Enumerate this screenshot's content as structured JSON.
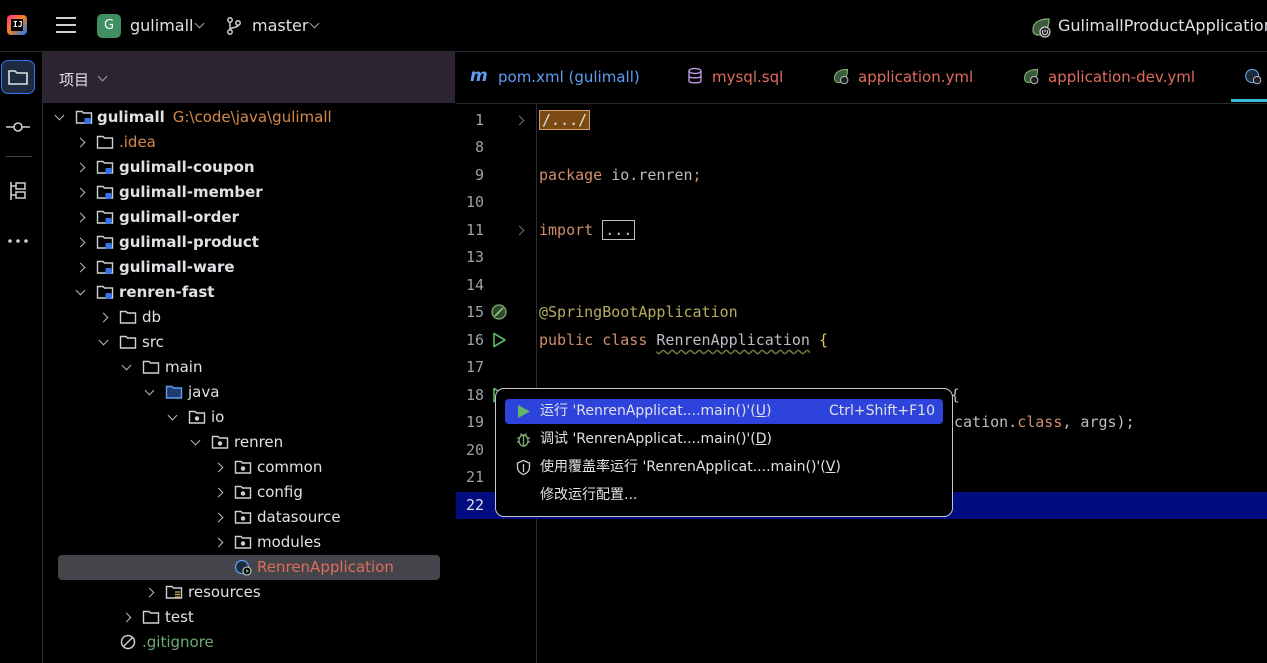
{
  "topbar": {
    "project_badge": "G",
    "project_name": "gulimall",
    "branch": "master",
    "run_config": "GulimallProductApplication"
  },
  "project_panel": {
    "title": "项目",
    "root_label": "gulimall",
    "root_path": "G:\\code\\java\\gulimall",
    "items": [
      {
        "label": ".idea"
      },
      {
        "label": "gulimall-coupon"
      },
      {
        "label": "gulimall-member"
      },
      {
        "label": "gulimall-order"
      },
      {
        "label": "gulimall-product"
      },
      {
        "label": "gulimall-ware"
      },
      {
        "label": "renren-fast"
      },
      {
        "label": "db"
      },
      {
        "label": "src"
      },
      {
        "label": "main"
      },
      {
        "label": "java"
      },
      {
        "label": "io"
      },
      {
        "label": "renren"
      },
      {
        "label": "common"
      },
      {
        "label": "config"
      },
      {
        "label": "datasource"
      },
      {
        "label": "modules"
      },
      {
        "label": "RenrenApplication"
      },
      {
        "label": "resources"
      },
      {
        "label": "test"
      },
      {
        "label": ".gitignore"
      }
    ]
  },
  "tabs": [
    {
      "label": "pom.xml (gulimall)"
    },
    {
      "label": "mysql.sql"
    },
    {
      "label": "application.yml"
    },
    {
      "label": "application-dev.yml"
    }
  ],
  "code": {
    "line_numbers": [
      "1",
      "8",
      "9",
      "10",
      "11",
      "13",
      "14",
      "15",
      "16",
      "17",
      "18",
      "19",
      "20",
      "21",
      "22"
    ],
    "fold_top": "/.../",
    "package_kw": "package",
    "package_name": "io.renren",
    "semi": ";",
    "import_kw": "import",
    "import_fold": "...",
    "annotation": "@SpringBootApplication",
    "public_kw": "public",
    "class_kw": "class",
    "class_name": "RenrenApplication",
    "brace_open": "{",
    "line18_partial": "(                ) {",
    "line19_partial": "cation.",
    "line19_class_kw": "class",
    "line19_rest": ", args);"
  },
  "popup": {
    "items": [
      {
        "label_prefix": "运行 'RenrenApplicat....main()'(",
        "mnemonic": "U",
        "label_suffix": ")",
        "shortcut": "Ctrl+Shift+F10"
      },
      {
        "label_prefix": "调试 'RenrenApplicat....main()'(",
        "mnemonic": "D",
        "label_suffix": ")"
      },
      {
        "label_prefix": "使用覆盖率运行 'RenrenApplicat....main()'(",
        "mnemonic": "V",
        "label_suffix": ")"
      },
      {
        "label_prefix": "修改运行配置..."
      }
    ]
  },
  "colors": {
    "accent": "#3574f0",
    "selection_highlight": "#2e43dc",
    "current_line": "#000c80",
    "keyword": "#cf8e6d",
    "annotation": "#b3ae60",
    "path_hint": "#d4894a"
  }
}
